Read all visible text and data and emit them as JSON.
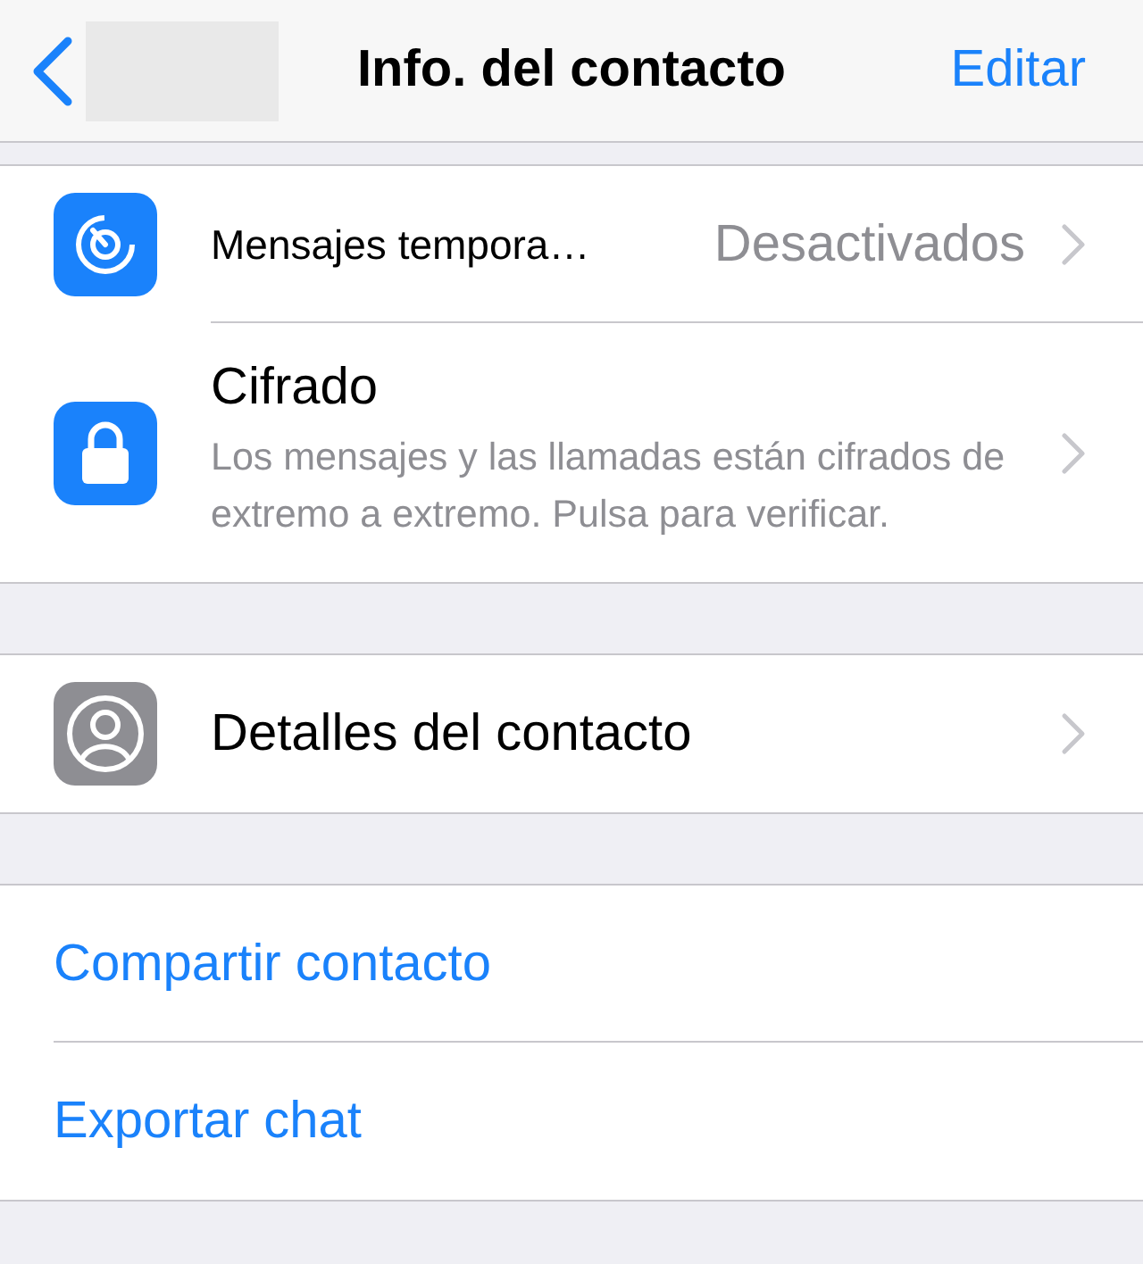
{
  "nav": {
    "title": "Info. del contacto",
    "edit": "Editar"
  },
  "sections": [
    {
      "rows": [
        {
          "kind": "value",
          "label": "Mensajes tempora…",
          "value": "Desactivados"
        },
        {
          "kind": "detail",
          "label": "Cifrado",
          "description": "Los mensajes y las llamadas están cifrados de extremo a extremo. Pulsa para verificar."
        }
      ]
    },
    {
      "rows": [
        {
          "kind": "plain",
          "label": "Detalles del contacto"
        }
      ]
    },
    {
      "rows": [
        {
          "kind": "action",
          "label": "Compartir contacto"
        },
        {
          "kind": "action",
          "label": "Exportar chat"
        }
      ]
    }
  ]
}
